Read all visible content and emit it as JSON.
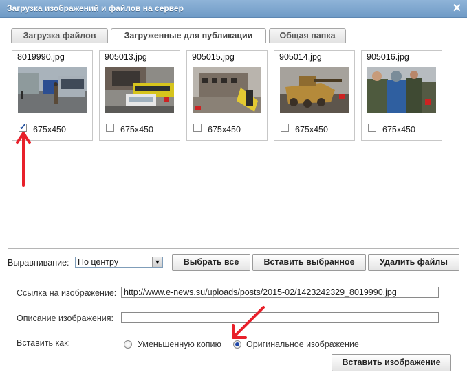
{
  "window": {
    "title": "Загрузка изображений и файлов на сервер"
  },
  "tabs": [
    {
      "label": "Загрузка файлов",
      "active": false
    },
    {
      "label": "Загруженные для публикации",
      "active": true
    },
    {
      "label": "Общая папка",
      "active": false
    }
  ],
  "images": [
    {
      "filename": "8019990.jpg",
      "size": "675x450",
      "checked": true
    },
    {
      "filename": "905013.jpg",
      "size": "675x450",
      "checked": false
    },
    {
      "filename": "905015.jpg",
      "size": "675x450",
      "checked": false
    },
    {
      "filename": "905014.jpg",
      "size": "675x450",
      "checked": false
    },
    {
      "filename": "905016.jpg",
      "size": "675x450",
      "checked": false
    }
  ],
  "toolbar": {
    "align_label": "Выравнивание:",
    "align_value": "По центру",
    "select_all": "Выбрать все",
    "insert_selected": "Вставить выбранное",
    "delete_files": "Удалить файлы"
  },
  "details": {
    "link_label": "Ссылка на изображение:",
    "link_value": "http://www.e-news.su/uploads/posts/2015-02/1423242329_8019990.jpg",
    "description_label": "Описание изображения:",
    "description_value": "",
    "insert_as_label": "Вставить как:",
    "option_thumb": "Уменьшенную копию",
    "option_original": "Оригинальное изображение",
    "selected_option": "original",
    "insert_button": "Вставить изображение"
  },
  "colors": {
    "annotation_arrow": "#e8202a",
    "title_bar": "#7ba4cd"
  }
}
